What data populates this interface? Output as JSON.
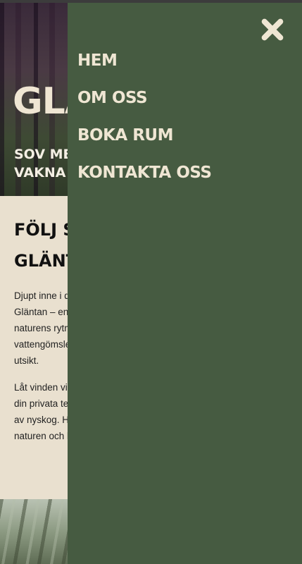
{
  "hero": {
    "title": "GLÄNTAN",
    "subtitle_line1": "SOV MED STJÄRNORNA,",
    "subtitle_line2": "VAKNA MED FÅGLARNA"
  },
  "content": {
    "heading_line1": "FÖLJ STIGEN TILL",
    "heading_line2": "GLÄNTAN",
    "paragraph1": "Djupt inne i den svenska skogen ligger\nGläntan – en plats där tiden saktar ner och\nnaturens rytm tar över. Här bor du i ett\nvattengömsle med en alldeles särskild\nutsikt.",
    "paragraph2": "Låt vinden viska genom trädkronorna runt\ndin privata terrass, långt från insyn och\nav nyskog. Här får du tid att uppleva\nnaturen och bara vara."
  },
  "nav": {
    "close_label": "Stäng meny",
    "items": [
      {
        "label": "HEM"
      },
      {
        "label": "OM OSS"
      },
      {
        "label": "BOKA RUM"
      },
      {
        "label": "KONTAKTA OSS"
      }
    ]
  },
  "colors": {
    "drawer_bg": "#465b41",
    "nav_text": "#efe6d3",
    "page_bg": "#e9e0cf"
  }
}
